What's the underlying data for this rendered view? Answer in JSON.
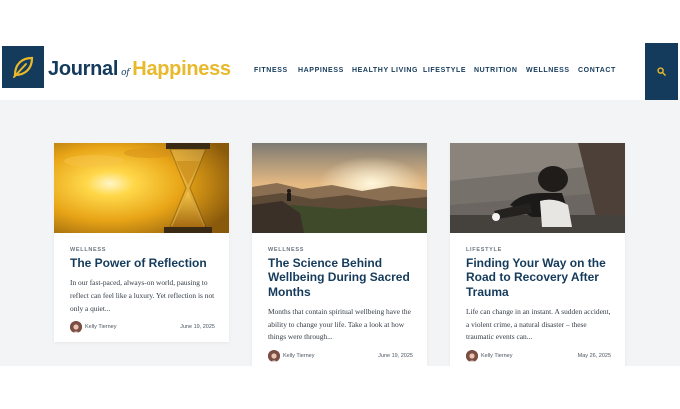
{
  "site": {
    "logo_word1": "Journal",
    "logo_of": "of",
    "logo_word2": "Happiness",
    "logo_icon": "leaf-icon"
  },
  "nav": {
    "items": [
      "FITNESS",
      "HAPPINESS",
      "HEALTHY LIVING",
      "LIFESTYLE",
      "NUTRITION",
      "WELLNESS",
      "CONTACT"
    ]
  },
  "search": {
    "icon": "search-icon"
  },
  "colors": {
    "brand_navy": "#153b5c",
    "brand_gold": "#e8b92b",
    "page_bg": "#f3f4f5"
  },
  "cards": [
    {
      "category": "WELLNESS",
      "title": "The Power of Reflection",
      "excerpt": "In our fast-paced, always-on world, pausing to reflect can feel like a luxury. Yet reflection is not only a quiet...",
      "author": "Kelly Tierney",
      "date": "June 19, 2025",
      "image": "hourglass-sunset-photo"
    },
    {
      "category": "WELLNESS",
      "title": "The Science Behind Wellbeing During Sacred Months",
      "excerpt": "Months that contain spiritual wellbeing have the ability to change your life. Take a look at how things were through...",
      "author": "Kelly Tierney",
      "date": "June 19, 2025",
      "image": "mountain-sunrise-photo"
    },
    {
      "category": "LIFESTYLE",
      "title": "Finding Your Way on the Road to Recovery After Trauma",
      "excerpt": "Life can change in an instant. A sudden accident, a violent crime, a natural disaster – these traumatic events can...",
      "author": "Kelly Tierney",
      "date": "May 26, 2025",
      "image": "person-sitting-steps-photo"
    }
  ]
}
